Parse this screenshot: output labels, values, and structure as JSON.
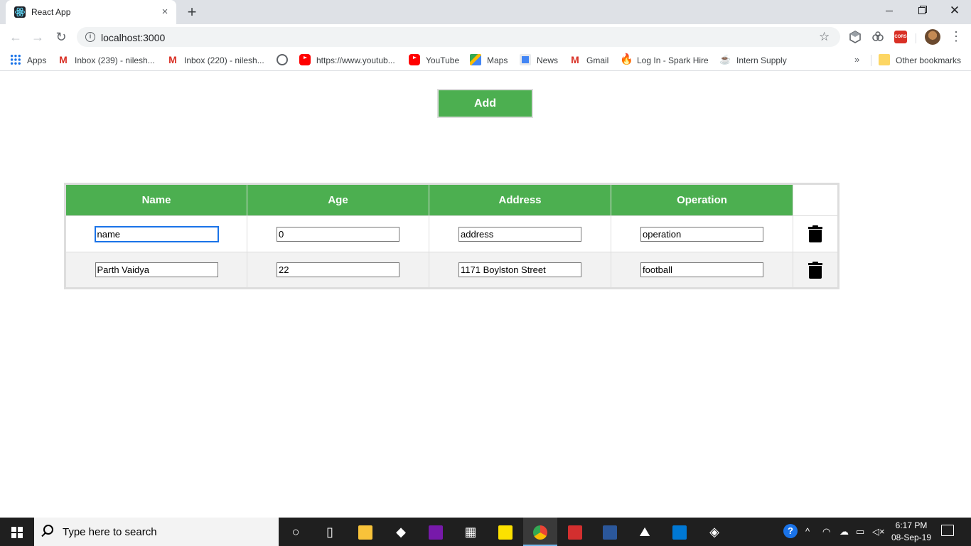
{
  "browser": {
    "tab_title": "React App",
    "tab_close": "×",
    "new_tab": "+",
    "url": "localhost:3000",
    "extension_cors": "CORS"
  },
  "bookmarks": [
    {
      "label": "Apps",
      "icon": "apps-grid-icon"
    },
    {
      "label": "Inbox (239) - nilesh...",
      "icon": "gmail-icon"
    },
    {
      "label": "Inbox (220) - nilesh...",
      "icon": "gmail-icon"
    },
    {
      "label": "",
      "icon": "globe-icon"
    },
    {
      "label": "https://www.youtub...",
      "icon": "youtube-icon"
    },
    {
      "label": "YouTube",
      "icon": "youtube-icon"
    },
    {
      "label": "Maps",
      "icon": "maps-icon"
    },
    {
      "label": "News",
      "icon": "news-icon"
    },
    {
      "label": "Gmail",
      "icon": "gmail-icon"
    },
    {
      "label": "Log In - Spark Hire",
      "icon": "fire-icon"
    },
    {
      "label": "Intern Supply",
      "icon": "cup-icon"
    }
  ],
  "bookmarks_more": "»",
  "other_bookmarks": "Other bookmarks",
  "page": {
    "add_label": "Add",
    "table": {
      "headers": [
        "Name",
        "Age",
        "Address",
        "Operation"
      ],
      "rows": [
        {
          "name": "name",
          "age": "0",
          "address": "address",
          "operation": "operation"
        },
        {
          "name": "Parth Vaidya",
          "age": "22",
          "address": "1171 Boylston Street",
          "operation": "football"
        }
      ]
    }
  },
  "taskbar": {
    "search_placeholder": "Type here to search",
    "time": "6:17 PM",
    "date": "08-Sep-19"
  },
  "colors": {
    "accent_green": "#4caf50",
    "border": "#dddddd",
    "stripe": "#f2f2f2"
  }
}
